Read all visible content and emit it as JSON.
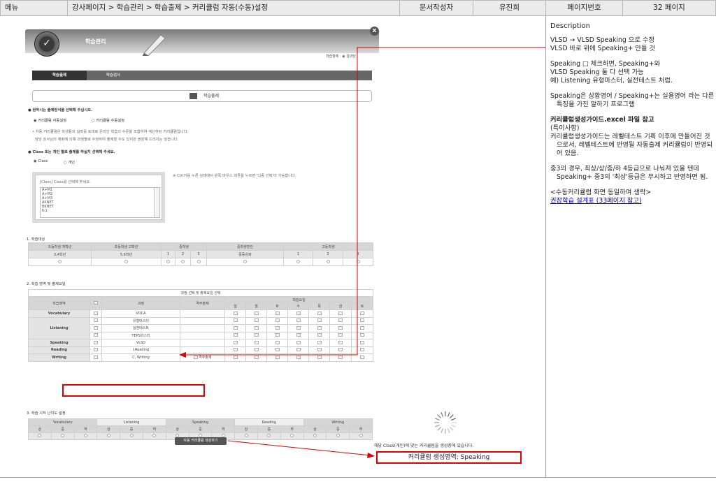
{
  "header": {
    "menu_label": "메뉴",
    "path": "강사페이지 > 학습관리 > 학습출제 > 커리큘럼 자동(수동)설정",
    "author_label": "문서작성자",
    "author_name": "유진희",
    "page_label": "페이지번호",
    "page_value": "32 페이지"
  },
  "description": {
    "title": "Description",
    "p1": [
      "VLSD → VLSD Speaking 으로 수정",
      "VLSD 바로 위에 Speaking+  만들 것"
    ],
    "p2": [
      "Speaking □ 체크하면, Speaking+와",
      "VLSD Speaking 둘 다 선택 가능",
      "예) Listening 유형마스터, 실전테스트 처럼."
    ],
    "p3": [
      "Speaking은 상황영어 / Speaking+는 실용영어 라는 다른 특징을 가진 말하기 프로그램"
    ],
    "p4_title": "커리큘럼생성가이드.excel 파일 참고",
    "p4": [
      "(특이사항)",
      "커리큘럼생성가이드는 레벨테스트 기획 이후에 만들어진 것으로서, 레벨테스트에 반영될 자동출제 커리큘럼이 반영되어 있음."
    ],
    "p5": [
      "중3의 경우, 최상/상/중/하 4등급으로 나눠져 있을 텐데 Speaking+ 중3의 '최상'등급은 무시하고 반영하면 됨."
    ],
    "p6": "<수동커리큘럼 화면 동일하여 생략>",
    "link": "권장학습 설계표 (33페이지 참고)"
  },
  "popup": {
    "title": "학습관리",
    "close": "x",
    "crumb": "학습출제 : ◉ 결과탄",
    "tabs": [
      "학습출제",
      "학습검사"
    ],
    "section_title": "학습출제",
    "q1": "원하시는 출제방식을 선택해 주십시오.",
    "mode_auto": "커리큘럼 자동설정",
    "mode_manual": "커리큘럼 수동설정",
    "note1": "• 자동 커리큘럼은 학생들의 실력를 토대로 온라인 학습의 수준을 조합하여 계산하된 커리큘럼입니다.",
    "note2": "담당 강사님의 재량에 의해 과정별로 수정하여 출제할 수도 있지만 권장해 드리지는 않습니다.",
    "q2": "Class 또는 개인 별로 출제를 하실지 선택해 주세요.",
    "class_opt": "Class",
    "person_opt": "개인",
    "class_hint": "[Class] Class를 선택해 주세요.",
    "ctrl_hint": "※ Ctrl키를 누른 상태에서 왼쪽 마우스 버튼을 누르면 '다중 선택'이 가능합니다.",
    "class_items": [
      "A+M1",
      "A+M2",
      "A+M3",
      "AKNET",
      "BKNET",
      "K-1"
    ],
    "sec1": "1. 학습대상",
    "target_headers": [
      "초등학생 저학년",
      "초등학생 고학년",
      "중학생",
      "중학생반인",
      "고등학생"
    ],
    "target_sub": [
      "3,4학년",
      "5,6학년",
      "1",
      "2",
      "3",
      "중등심화",
      "1",
      "2",
      "3"
    ],
    "sec2": "2. 학습 영역 및 출제요일",
    "table2_title": "과정 선택 및 출제요일 선택",
    "col_area": "학습영역",
    "col_course": "과정",
    "col_weekly": "격주출제",
    "col_days": "학습요일",
    "days": [
      "일",
      "월",
      "화",
      "수",
      "목",
      "금",
      "토"
    ],
    "areas": [
      "Vocabulary",
      "Listening",
      "Speaking",
      "Reading",
      "Writing"
    ],
    "courses": [
      "VOCA",
      "유형마스터",
      "실전테스트",
      "TEPS마스터",
      "VLSD",
      "I,Reading",
      "C, Writing"
    ],
    "weekly_label": "격주출제",
    "sec3": "3. 학습 시작 난이도 설정",
    "diff_areas": [
      "Vocabulary",
      "Listening",
      "Speaking",
      "Reading",
      "Writing"
    ],
    "diff_levels": [
      "상",
      "중",
      "하"
    ],
    "gen_btn": "자동 커리큘럼 생성하기",
    "result_line": "해당 Class(개인)에 맞는 커리큘럼을 생성중에 있습니다.",
    "result_box": "커리큘럼 생성영역: Speaking"
  }
}
